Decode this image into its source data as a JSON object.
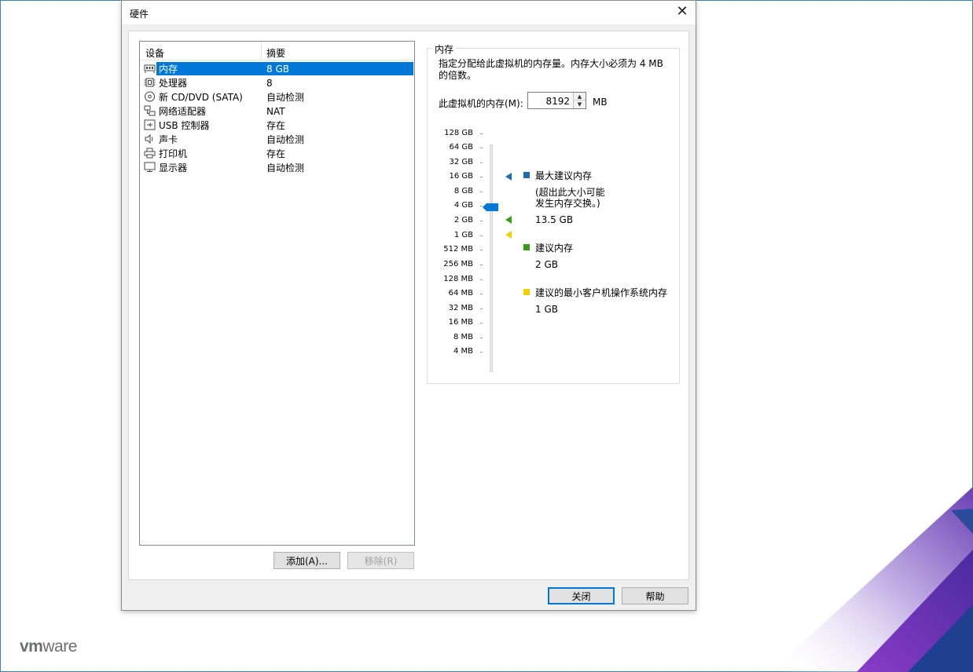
{
  "dialog": {
    "title": "硬件"
  },
  "device_list": {
    "col_device": "设备",
    "col_summary": "摘要",
    "rows": [
      {
        "name": "内存",
        "summary": "8 GB",
        "icon": "memory-icon",
        "selected": true
      },
      {
        "name": "处理器",
        "summary": "8",
        "icon": "cpu-icon"
      },
      {
        "name": "新 CD/DVD (SATA)",
        "summary": "自动检测",
        "icon": "disc-icon"
      },
      {
        "name": "网络适配器",
        "summary": "NAT",
        "icon": "network-icon"
      },
      {
        "name": "USB 控制器",
        "summary": "存在",
        "icon": "usb-icon"
      },
      {
        "name": "声卡",
        "summary": "自动检测",
        "icon": "speaker-icon"
      },
      {
        "name": "打印机",
        "summary": "存在",
        "icon": "printer-icon"
      },
      {
        "name": "显示器",
        "summary": "自动检测",
        "icon": "monitor-icon"
      }
    ]
  },
  "buttons": {
    "add": "添加(A)...",
    "remove": "移除(R)",
    "close": "关闭",
    "help": "帮助"
  },
  "memory": {
    "group_title": "内存",
    "description": "指定分配给此虚拟机的内存量。内存大小必须为 4 MB 的倍数。",
    "field_label": "此虚拟机的内存(M):",
    "value": "8192",
    "unit": "MB",
    "scale": [
      "128 GB",
      "64 GB",
      "32 GB",
      "16 GB",
      "8 GB",
      "4 GB",
      "2 GB",
      "1 GB",
      "512 MB",
      "256 MB",
      "128 MB",
      "64 MB",
      "32 MB",
      "16 MB",
      "8 MB",
      "4 MB"
    ],
    "legend": {
      "max_title": "最大建议内存",
      "max_note_1": "(超出此大小可能",
      "max_note_2": "发生内存交换。)",
      "max_value": "13.5 GB",
      "rec_title": "建议内存",
      "rec_value": "2 GB",
      "min_title": "建议的最小客户机操作系统内存",
      "min_value": "1 GB"
    },
    "colors": {
      "max": "#1e6bb0",
      "recommended": "#3a9a1a",
      "minimum": "#f0d000",
      "thumb": "#0078d7"
    }
  },
  "branding": {
    "logo_vm": "vm",
    "logo_ware": "ware"
  }
}
